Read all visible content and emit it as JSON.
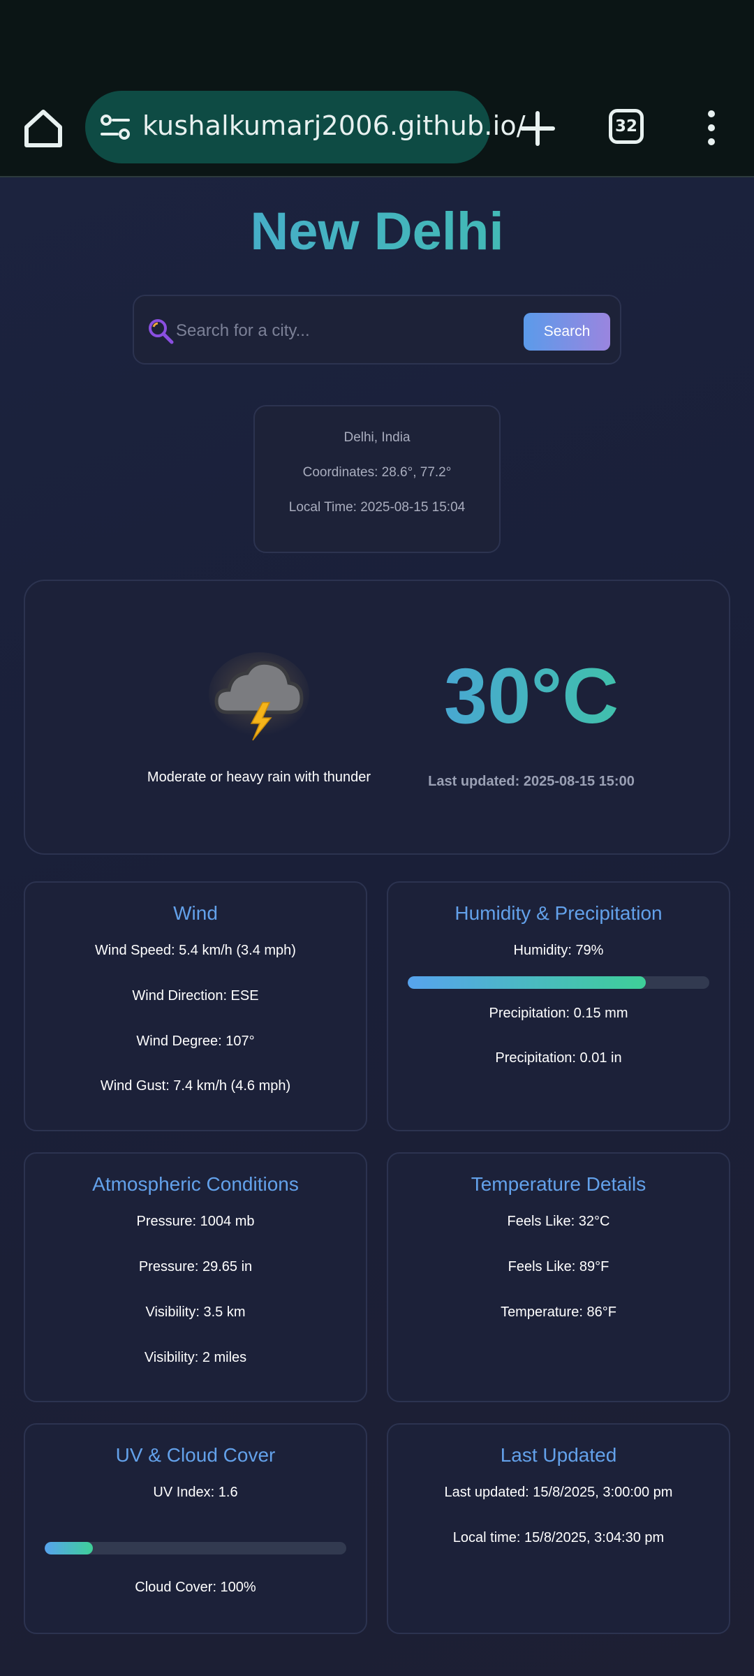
{
  "browser": {
    "url": "kushalkumarj2006.github.io/",
    "tab_count": "32"
  },
  "page": {
    "city_title": "New Delhi",
    "search": {
      "placeholder": "Search for a city...",
      "button_label": "Search"
    },
    "location": {
      "place": "Delhi, India",
      "coordinates": "Coordinates: 28.6°, 77.2°",
      "local_time": "Local Time: 2025-08-15 15:04"
    },
    "current": {
      "icon": "thunderstorm-icon",
      "condition": "Moderate or heavy rain with thunder",
      "temperature": "30°C",
      "last_updated": "Last updated: 2025-08-15 15:00"
    },
    "wind": {
      "title": "Wind",
      "speed": "Wind Speed: 5.4 km/h (3.4 mph)",
      "direction": "Wind Direction: ESE",
      "degree": "Wind Degree: 107°",
      "gust": "Wind Gust: 7.4 km/h (4.6 mph)"
    },
    "humidity": {
      "title": "Humidity & Precipitation",
      "humidity": "Humidity: 79%",
      "humidity_fraction": 0.79,
      "precip_mm": "Precipitation: 0.15 mm",
      "precip_in": "Precipitation: 0.01 in"
    },
    "atmosphere": {
      "title": "Atmospheric Conditions",
      "pressure_mb": "Pressure: 1004 mb",
      "pressure_in": "Pressure: 29.65 in",
      "visibility_km": "Visibility: 3.5 km",
      "visibility_miles": "Visibility: 2 miles"
    },
    "temperature": {
      "title": "Temperature Details",
      "feels_c": "Feels Like: 32°C",
      "feels_f": "Feels Like: 89°F",
      "temp_f": "Temperature: 86°F"
    },
    "uv": {
      "title": "UV & Cloud Cover",
      "uv_index": "UV Index: 1.6",
      "uv_fraction": 0.16,
      "cloud_cover": "Cloud Cover: 100%"
    },
    "updated": {
      "title": "Last Updated",
      "last_updated": "Last updated: 15/8/2025, 3:00:00 pm",
      "local_time": "Local time: 15/8/2025, 3:04:30 pm"
    }
  },
  "colors": {
    "title_gradient_start": "#4aa3d9",
    "title_gradient_end": "#3fc5a4",
    "accent_blue": "#63a1ea",
    "bar_start": "#57a3ee",
    "bar_end": "#3ecf98"
  }
}
